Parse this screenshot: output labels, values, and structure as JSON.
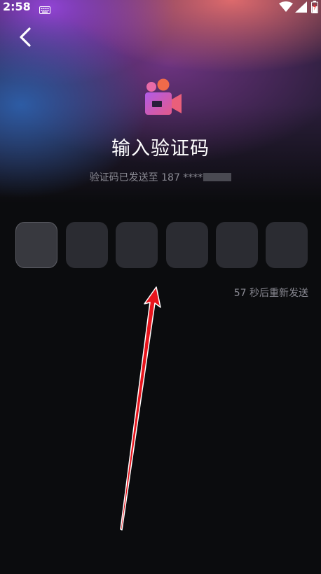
{
  "status_bar": {
    "time": "2:58",
    "icons": [
      "keyboard-icon",
      "wifi-icon",
      "signal-icon",
      "battery-icon"
    ]
  },
  "nav": {
    "back_icon": "chevron-left-icon"
  },
  "header": {
    "app_icon": "video-camera-icon",
    "title": "输入验证码",
    "subtitle_prefix": "验证码已发送至 187 ****"
  },
  "code_input": {
    "digits": [
      "",
      "",
      "",
      "",
      "",
      ""
    ],
    "active_index": 0
  },
  "resend": {
    "countdown_text": "57 秒后重新发送"
  },
  "colors": {
    "background": "#0b0c0e",
    "box": "#2b2c32",
    "muted_text": "#8a8a93",
    "arrow": "#e8141c"
  }
}
